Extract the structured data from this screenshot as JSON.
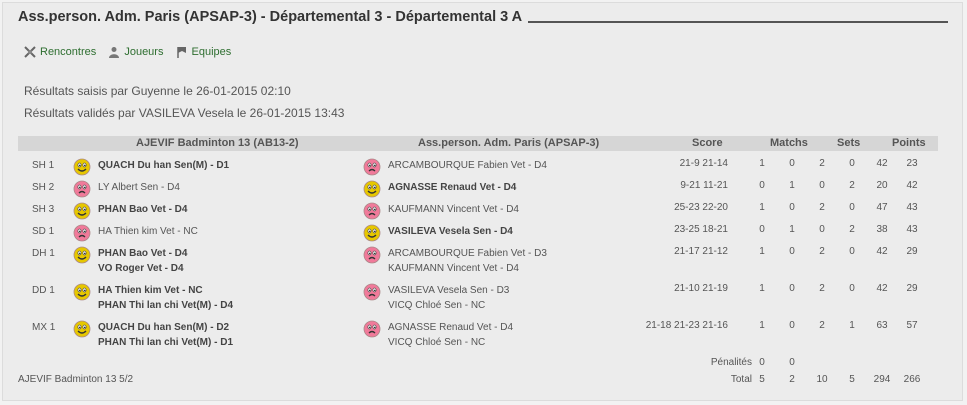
{
  "title": "Ass.person. Adm. Paris (APSAP-3) - Départemental 3 - Départemental 3 A",
  "nav": {
    "items": [
      {
        "label": "Rencontres",
        "icon": "tournament-icon"
      },
      {
        "label": "Joueurs",
        "icon": "players-icon"
      },
      {
        "label": "Equipes",
        "icon": "flag-icon"
      }
    ]
  },
  "info": {
    "entered": "Résultats saisis par Guyenne le 26-01-2015 02:10",
    "validated": "Résultats validés par VASILEVA Vesela le 26-01-2015 13:43"
  },
  "table": {
    "headers": {
      "home": "AJEVIF Badminton 13 (AB13-2)",
      "away": "Ass.person. Adm. Paris (APSAP-3)",
      "score": "Score",
      "matchs": "Matchs",
      "sets": "Sets",
      "points": "Points"
    },
    "rows": [
      {
        "code": "SH 1",
        "home": [
          "QUACH Du han Sen(M) - D1"
        ],
        "home_win": true,
        "away": [
          "ARCAMBOURQUE Fabien Vet - D4"
        ],
        "score": "21-9 21-14",
        "m1": "1",
        "m2": "0",
        "s1": "2",
        "s2": "0",
        "p1": "42",
        "p2": "23"
      },
      {
        "code": "SH 2",
        "home": [
          "LY Albert Sen - D4"
        ],
        "home_win": false,
        "away": [
          "AGNASSE Renaud Vet - D4"
        ],
        "score": "9-21 11-21",
        "m1": "0",
        "m2": "1",
        "s1": "0",
        "s2": "2",
        "p1": "20",
        "p2": "42"
      },
      {
        "code": "SH 3",
        "home": [
          "PHAN Bao Vet - D4"
        ],
        "home_win": true,
        "away": [
          "KAUFMANN Vincent Vet - D4"
        ],
        "score": "25-23 22-20",
        "m1": "1",
        "m2": "0",
        "s1": "2",
        "s2": "0",
        "p1": "47",
        "p2": "43"
      },
      {
        "code": "SD 1",
        "home": [
          "HA Thien kim Vet - NC"
        ],
        "home_win": false,
        "away": [
          "VASILEVA Vesela Sen - D4"
        ],
        "score": "23-25 18-21",
        "m1": "0",
        "m2": "1",
        "s1": "0",
        "s2": "2",
        "p1": "38",
        "p2": "43"
      },
      {
        "code": "DH 1",
        "home": [
          "PHAN Bao Vet - D4",
          "VO Roger Vet - D4"
        ],
        "home_win": true,
        "away": [
          "ARCAMBOURQUE Fabien Vet - D3",
          "KAUFMANN Vincent Vet - D4"
        ],
        "score": "21-17 21-12",
        "m1": "1",
        "m2": "0",
        "s1": "2",
        "s2": "0",
        "p1": "42",
        "p2": "29"
      },
      {
        "code": "DD 1",
        "home": [
          "HA Thien kim Vet - NC",
          "PHAN Thi lan chi Vet(M) - D4"
        ],
        "home_win": true,
        "away": [
          "VASILEVA Vesela Sen - D3",
          "VICQ Chloé Sen - NC"
        ],
        "score": "21-10 21-19",
        "m1": "1",
        "m2": "0",
        "s1": "2",
        "s2": "0",
        "p1": "42",
        "p2": "29"
      },
      {
        "code": "MX 1",
        "home": [
          "QUACH Du han Sen(M) - D2",
          "PHAN Thi lan chi Vet(M) - D1"
        ],
        "home_win": true,
        "away": [
          "AGNASSE Renaud Vet - D4",
          "VICQ Chloé Sen - NC"
        ],
        "score": "21-18 21-23 21-16",
        "m1": "1",
        "m2": "0",
        "s1": "2",
        "s2": "1",
        "p1": "63",
        "p2": "57"
      }
    ],
    "penalties": {
      "label": "Pénalités",
      "m1": "0",
      "m2": "0"
    },
    "total": {
      "label": "Total",
      "m1": "5",
      "m2": "2",
      "s1": "10",
      "s2": "5",
      "p1": "294",
      "p2": "266"
    }
  },
  "footer": {
    "left": "AJEVIF Badminton 13 5/2"
  },
  "colors": {
    "win_face": "#e6c700",
    "loss_face": "#f07a9a",
    "nav": "#2e6e30"
  }
}
